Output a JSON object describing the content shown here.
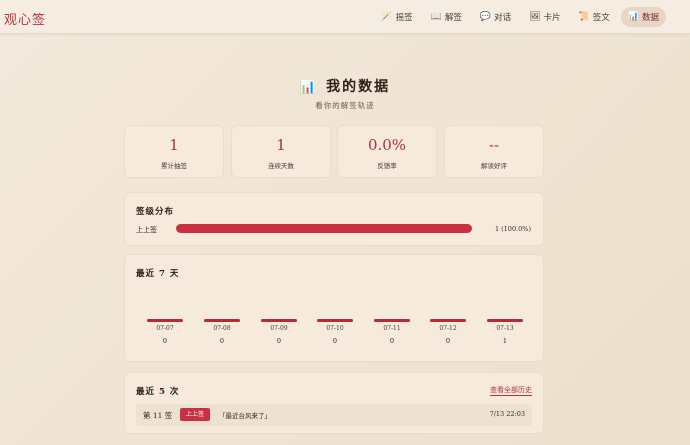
{
  "app": {
    "brand": "观心签"
  },
  "nav": [
    {
      "label": "摇签",
      "icon": "🪄",
      "icon_name": "wand-icon",
      "active": false
    },
    {
      "label": "解签",
      "icon": "📖",
      "icon_name": "book-icon",
      "active": false
    },
    {
      "label": "对话",
      "icon": "💬",
      "icon_name": "chat-bubble-icon",
      "active": false
    },
    {
      "label": "卡片",
      "icon": "🖼",
      "icon_name": "picture-card-icon",
      "active": false
    },
    {
      "label": "签文",
      "icon": "📜",
      "icon_name": "scroll-icon",
      "active": false
    },
    {
      "label": "数据",
      "icon": "📊",
      "icon_name": "bar-chart-icon",
      "active": true
    }
  ],
  "page": {
    "title_icon": "📊",
    "title": "我的数据",
    "subtitle": "看你的解签轨迹"
  },
  "stats": [
    {
      "value": "1",
      "label": "累计抽签"
    },
    {
      "value": "1",
      "label": "连续天数"
    },
    {
      "value": "0.0%",
      "label": "反馈率"
    },
    {
      "value": "--",
      "label": "解读好评"
    }
  ],
  "distribution": {
    "title": "签级分布",
    "items": [
      {
        "label": "上上签",
        "fraction": 1.0,
        "count_text": "1 (100.0%)"
      }
    ]
  },
  "recent_days": {
    "title": "最近 7 天",
    "days": [
      {
        "date": "07-07",
        "count": "0"
      },
      {
        "date": "07-08",
        "count": "0"
      },
      {
        "date": "07-09",
        "count": "0"
      },
      {
        "date": "07-10",
        "count": "0"
      },
      {
        "date": "07-11",
        "count": "0"
      },
      {
        "date": "07-12",
        "count": "0"
      },
      {
        "date": "07-13",
        "count": "1"
      }
    ]
  },
  "recent_history": {
    "title": "最近 5 次",
    "view_all": "查看全部历史",
    "items": [
      {
        "number": "第 11 签",
        "level": "上上签",
        "question": "「最近台风来了」",
        "time": "7/13 22:03"
      }
    ]
  },
  "colors": {
    "accent": "#b3353a",
    "bar": "#c93141",
    "background": "#efe3d2"
  }
}
